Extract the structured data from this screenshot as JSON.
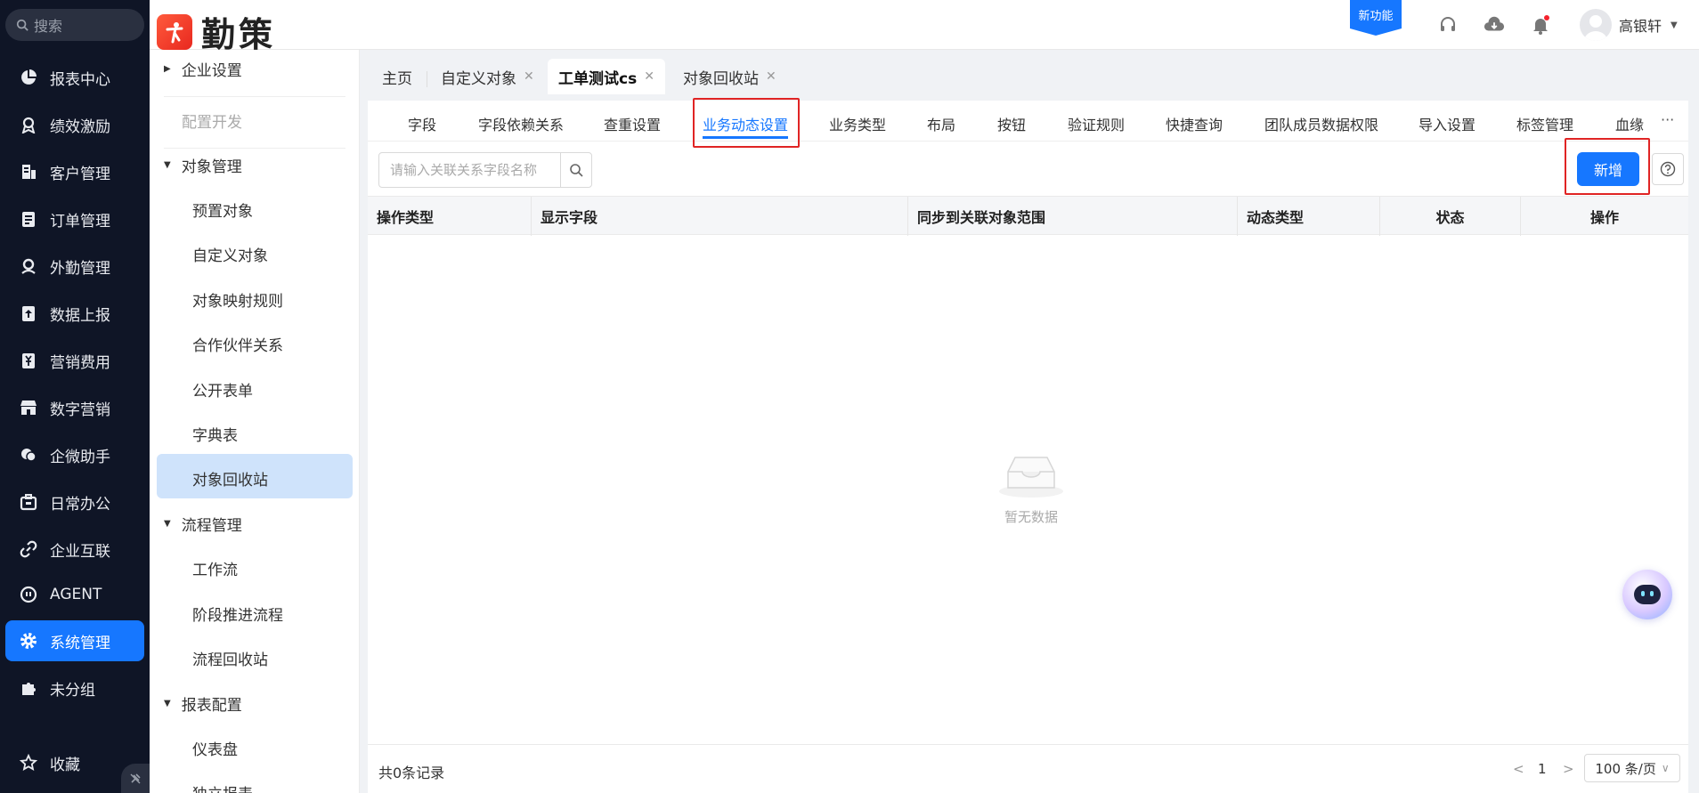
{
  "nav": {
    "search_placeholder": "搜索",
    "items": [
      {
        "label": "报表中心",
        "icon": "pie-chart-icon"
      },
      {
        "label": "绩效激励",
        "icon": "award-icon"
      },
      {
        "label": "客户管理",
        "icon": "building-icon"
      },
      {
        "label": "订单管理",
        "icon": "clipboard-icon"
      },
      {
        "label": "外勤管理",
        "icon": "location-pin-icon"
      },
      {
        "label": "数据上报",
        "icon": "upload-icon"
      },
      {
        "label": "营销费用",
        "icon": "yen-icon"
      },
      {
        "label": "数字营销",
        "icon": "store-icon"
      },
      {
        "label": "企微助手",
        "icon": "chat-icon"
      },
      {
        "label": "日常办公",
        "icon": "briefcase-icon"
      },
      {
        "label": "企业互联",
        "icon": "link-icon"
      },
      {
        "label": "AGENT",
        "icon": "robot-icon"
      },
      {
        "label": "系统管理",
        "icon": "gear-icon",
        "active": true
      },
      {
        "label": "未分组",
        "icon": "puzzle-icon"
      }
    ],
    "favorites_label": "收藏"
  },
  "topbar": {
    "brand": "勤策",
    "new_feature": "新功能",
    "user_name": "高银轩"
  },
  "side2": {
    "enterprise_settings": "企业设置",
    "config_dev": "配置开发",
    "object_mgmt": "对象管理",
    "object_items": [
      "预置对象",
      "自定义对象",
      "对象映射规则",
      "合作伙伴关系",
      "公开表单",
      "字典表",
      "对象回收站"
    ],
    "process_mgmt": "流程管理",
    "process_items": [
      "工作流",
      "阶段推进流程",
      "流程回收站"
    ],
    "report_config": "报表配置",
    "report_items": [
      "仪表盘",
      "独立报表"
    ]
  },
  "page_tabs": [
    {
      "label": "主页",
      "closable": false
    },
    {
      "label": "自定义对象",
      "closable": true
    },
    {
      "label": "工单测试cs",
      "closable": true,
      "active": true
    },
    {
      "label": "对象回收站",
      "closable": true
    }
  ],
  "sub_tabs": [
    "字段",
    "字段依赖关系",
    "查重设置",
    "业务动态设置",
    "业务类型",
    "布局",
    "按钮",
    "验证规则",
    "快捷查询",
    "团队成员数据权限",
    "导入设置",
    "标签管理",
    "血缘"
  ],
  "active_sub_tab": "业务动态设置",
  "search": {
    "placeholder": "请输入关联关系字段名称",
    "value": ""
  },
  "add_label": "新增",
  "table": {
    "headers": [
      "操作类型",
      "显示字段",
      "同步到关联对象范围",
      "动态类型",
      "状态",
      "操作"
    ],
    "rows": []
  },
  "empty_text": "暂无数据",
  "footer": {
    "total": "共0条记录",
    "page": "1",
    "page_size": "100 条/页"
  },
  "colors": {
    "accent": "#1677ff",
    "nav_bg": "#0f1526",
    "highlight": "#e02424"
  }
}
